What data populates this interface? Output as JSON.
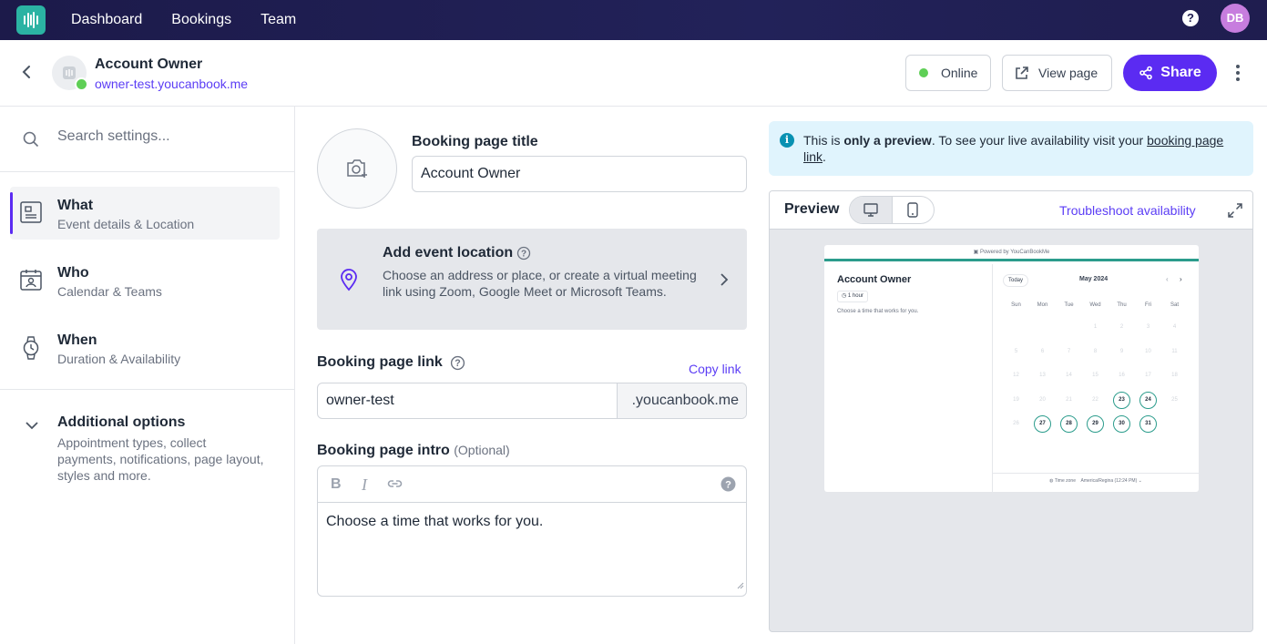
{
  "nav": {
    "links": [
      "Dashboard",
      "Bookings",
      "Team"
    ],
    "help": "?",
    "avatar": "DB"
  },
  "header": {
    "account_name": "Account Owner",
    "account_url": "owner-test.youcanbook.me",
    "status_label": "Online",
    "view_page_label": "View page",
    "share_label": "Share"
  },
  "sidebar": {
    "search_placeholder": "Search settings...",
    "items": [
      {
        "title": "What",
        "subtitle": "Event details & Location"
      },
      {
        "title": "Who",
        "subtitle": "Calendar & Teams"
      },
      {
        "title": "When",
        "subtitle": "Duration & Availability"
      }
    ],
    "additional": {
      "title": "Additional options",
      "subtitle": "Appointment types, collect payments, notifications, page layout, styles and more."
    }
  },
  "form": {
    "title_label": "Booking page title",
    "title_value": "Account Owner",
    "location_title": "Add event location",
    "location_desc": "Choose an address or place, or create a virtual meeting link using Zoom, Google Meet or Microsoft Teams.",
    "link_label": "Booking page link",
    "copy_link": "Copy link",
    "link_value": "owner-test",
    "link_suffix": ".youcanbook.me",
    "intro_label": "Booking page intro",
    "intro_optional": "(Optional)",
    "intro_value": "Choose a time that works for you."
  },
  "preview": {
    "info_prefix": "This is ",
    "info_bold": "only a preview",
    "info_mid": ". To see your live availability visit your ",
    "info_link": "booking page link",
    "info_suffix": ".",
    "title": "Preview",
    "troubleshoot": "Troubleshoot availability",
    "mini": {
      "powered": "Powered by YouCanBookMe",
      "name": "Account Owner",
      "duration": "1 hour",
      "intro": "Choose a time that works for you.",
      "today": "Today",
      "month": "May 2024",
      "weekdays": [
        "Sun",
        "Mon",
        "Tue",
        "Wed",
        "Thu",
        "Fri",
        "Sat"
      ],
      "available_days": [
        23,
        24,
        27,
        28,
        29,
        30,
        31
      ],
      "timezone_label": "Time zone",
      "timezone_value": "America/Regina (12:24 PM)"
    }
  }
}
